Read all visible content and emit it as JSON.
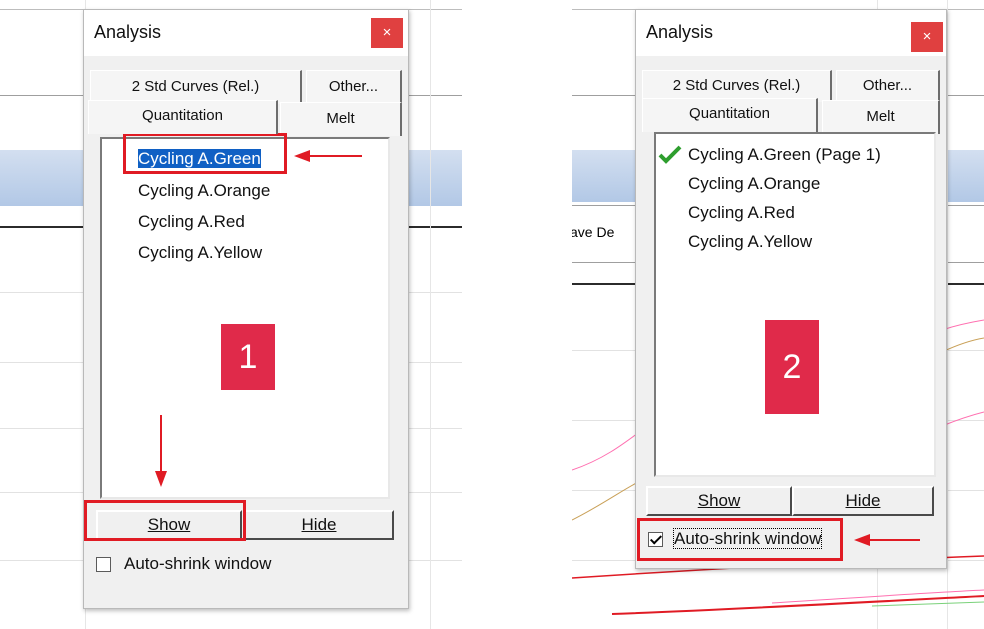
{
  "left": {
    "dialog": {
      "title": "Analysis",
      "close_icon": "close-icon",
      "tabs_back": [
        "2 Std Curves (Rel.)",
        "Other..."
      ],
      "tabs_front": [
        "Quantitation",
        "Melt"
      ],
      "active_tab": "Quantitation",
      "list_items": [
        "Cycling A.Green",
        "Cycling A.Orange",
        "Cycling A.Red",
        "Cycling A.Yellow"
      ],
      "selected_item": "Cycling A.Green",
      "buttons": {
        "show": "Show",
        "hide": "Hide"
      },
      "auto_shrink": {
        "label": "Auto-shrink window",
        "checked": false
      }
    },
    "step_number": "1"
  },
  "right": {
    "background_label": "ave De",
    "dialog": {
      "title": "Analysis",
      "close_icon": "close-icon",
      "tabs_back": [
        "2 Std Curves (Rel.)",
        "Other..."
      ],
      "tabs_front": [
        "Quantitation",
        "Melt"
      ],
      "active_tab": "Quantitation",
      "list_items": [
        "Cycling A.Green (Page 1)",
        "Cycling A.Orange",
        "Cycling A.Red",
        "Cycling A.Yellow"
      ],
      "shown_item_icon": "checkmark-icon",
      "buttons": {
        "show": "Show",
        "hide": "Hide"
      },
      "auto_shrink": {
        "label": "Auto-shrink window",
        "checked": true
      }
    },
    "step_number": "2"
  },
  "colors": {
    "highlight": "#e01b24",
    "badge": "#e02a4a",
    "selection": "#1060c4",
    "close_button": "#e04040",
    "check_green": "#2e9e2e"
  }
}
